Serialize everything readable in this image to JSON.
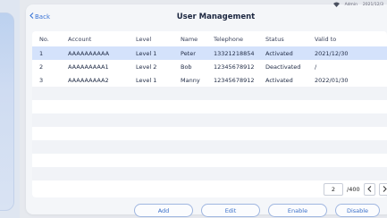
{
  "status_bar": {
    "user": "Admin",
    "datetime": "2021/12/3"
  },
  "header": {
    "back_label": "Back",
    "title": "User Management"
  },
  "table": {
    "columns": [
      "No.",
      "Account",
      "Level",
      "Name",
      "Telephone",
      "Status",
      "Valid to"
    ],
    "rows": [
      {
        "no": "1",
        "account": "AAAAAAAAAA",
        "level": "Level 1",
        "name": "Peter",
        "telephone": "13321218854",
        "status": "Activated",
        "valid_to": "2021/12/30"
      },
      {
        "no": "2",
        "account": "AAAAAAAAA1",
        "level": "Level 2",
        "name": "Bob",
        "telephone": "12345678912",
        "status": "Deactivated",
        "valid_to": "/"
      },
      {
        "no": "3",
        "account": "AAAAAAAAA2",
        "level": "Level 1",
        "name": "Manny",
        "telephone": "12345678912",
        "status": "Activated",
        "valid_to": "2022/01/30"
      }
    ],
    "selected_row": 1
  },
  "pagination": {
    "current": "2",
    "total": "/400",
    "prev_icon": "chevron-left-icon",
    "next_icon": "chevron-right-icon"
  },
  "actions": {
    "add": "Add",
    "edit": "Edit",
    "enable": "Enable",
    "disable": "Disable"
  },
  "colors": {
    "accent": "#3a74d6",
    "selected_row": "#d4e2fb",
    "alt_row": "#f1f3f7"
  }
}
